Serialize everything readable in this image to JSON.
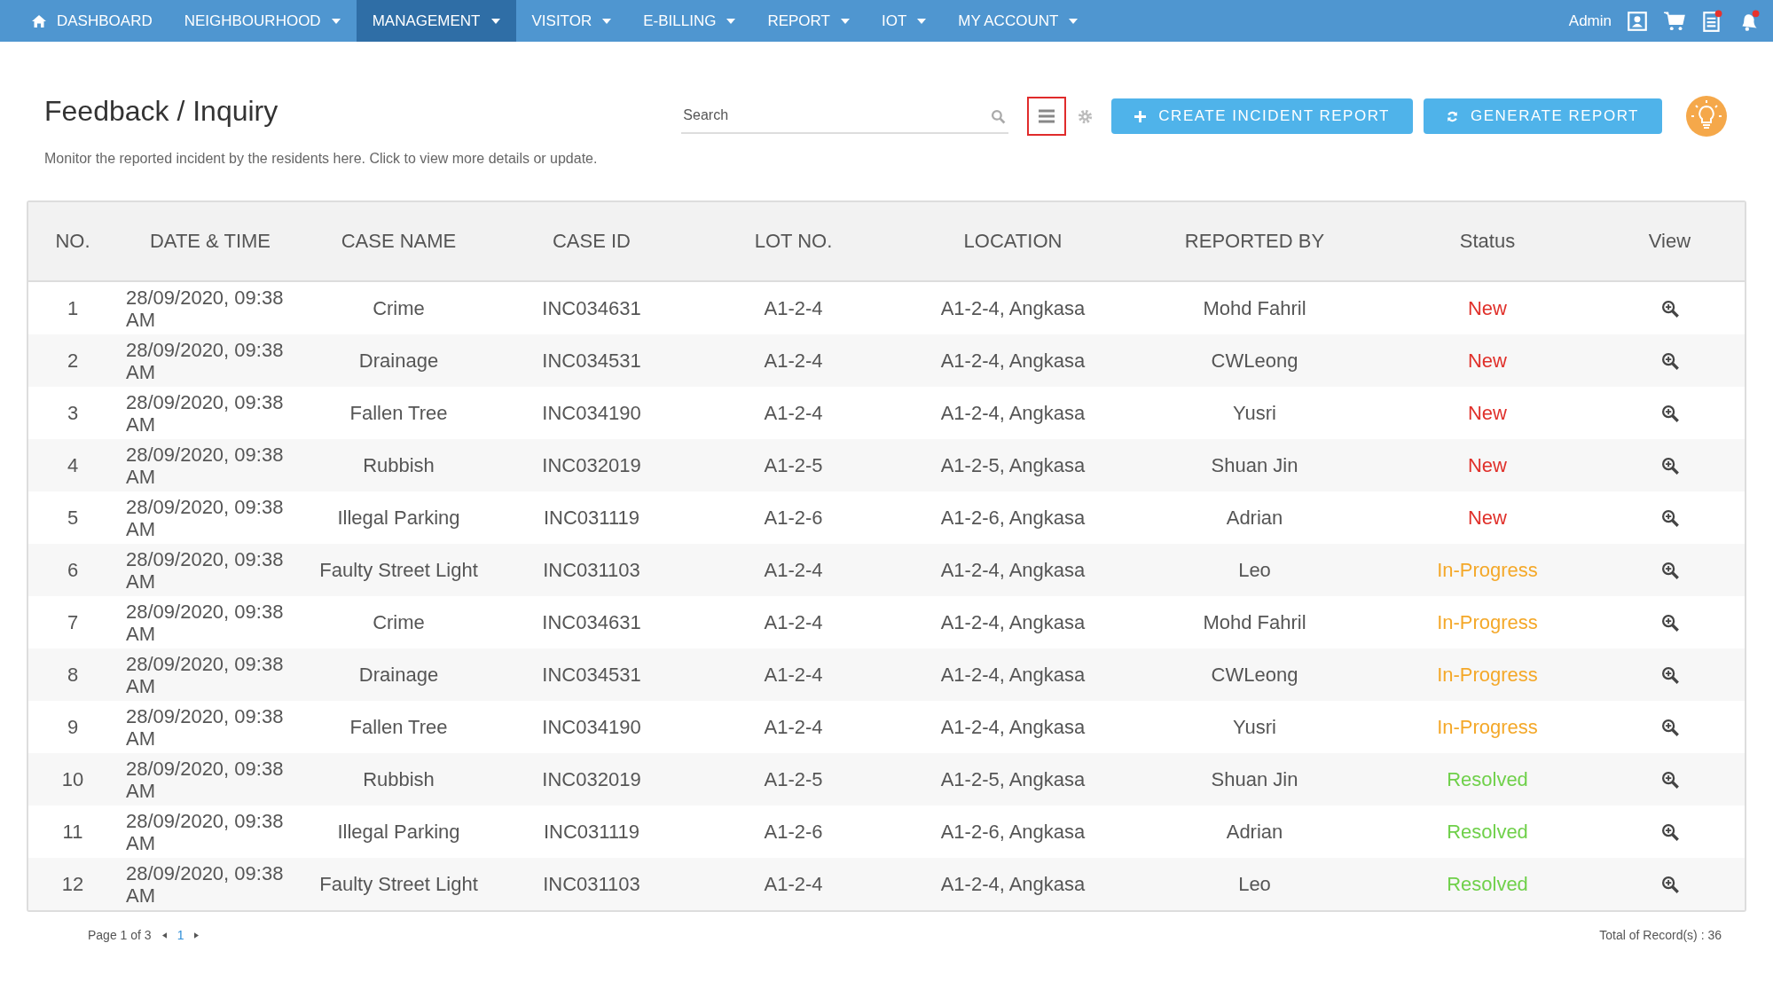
{
  "nav": {
    "items": [
      {
        "label": "DASHBOARD",
        "kind": "home",
        "selected": false
      },
      {
        "label": "NEIGHBOURHOOD",
        "kind": "menu",
        "selected": false
      },
      {
        "label": "MANAGEMENT",
        "kind": "menu",
        "selected": true
      },
      {
        "label": "VISITOR",
        "kind": "menu",
        "selected": false
      },
      {
        "label": "E-BILLING",
        "kind": "menu",
        "selected": false
      },
      {
        "label": "REPORT",
        "kind": "menu",
        "selected": false
      },
      {
        "label": "IOT",
        "kind": "menu",
        "selected": false
      },
      {
        "label": "MY ACCOUNT",
        "kind": "menu",
        "selected": false
      }
    ],
    "user": "Admin"
  },
  "page": {
    "title": "Feedback / Inquiry",
    "description": "Monitor the reported incident by the residents here. Click to view more details or update.",
    "search": {
      "placeholder": "Search"
    },
    "buttons": [
      "CREATE INCIDENT REPORT",
      "GENERATE REPORT"
    ]
  },
  "table": {
    "columns": [
      "NO.",
      "DATE & TIME",
      "CASE NAME",
      "CASE ID",
      "LOT NO.",
      "LOCATION",
      "REPORTED BY",
      "Status",
      "View"
    ],
    "rows": [
      {
        "no": "1",
        "date": "28/09/2020, 09:38 AM",
        "case_name": "Crime",
        "case_id": "INC034631",
        "lot": "A1-2-4",
        "location": "A1-2-4, Angkasa",
        "reported_by": "Mohd Fahril",
        "status": "New",
        "color": "#e0302a"
      },
      {
        "no": "2",
        "date": "28/09/2020, 09:38 AM",
        "case_name": "Drainage",
        "case_id": "INC034531",
        "lot": "A1-2-4",
        "location": "A1-2-4, Angkasa",
        "reported_by": "CWLeong",
        "status": "New",
        "color": "#e0302a"
      },
      {
        "no": "3",
        "date": "28/09/2020, 09:38 AM",
        "case_name": "Fallen Tree",
        "case_id": "INC034190",
        "lot": "A1-2-4",
        "location": "A1-2-4, Angkasa",
        "reported_by": "Yusri",
        "status": "New",
        "color": "#e0302a"
      },
      {
        "no": "4",
        "date": "28/09/2020, 09:38 AM",
        "case_name": "Rubbish",
        "case_id": "INC032019",
        "lot": "A1-2-5",
        "location": "A1-2-5, Angkasa",
        "reported_by": "Shuan Jin",
        "status": "New",
        "color": "#e0302a"
      },
      {
        "no": "5",
        "date": "28/09/2020, 09:38 AM",
        "case_name": "Illegal Parking",
        "case_id": "INC031119",
        "lot": "A1-2-6",
        "location": "A1-2-6, Angkasa",
        "reported_by": "Adrian",
        "status": "New",
        "color": "#e0302a"
      },
      {
        "no": "6",
        "date": "28/09/2020, 09:38 AM",
        "case_name": "Faulty Street Light",
        "case_id": "INC031103",
        "lot": "A1-2-4",
        "location": "A1-2-4, Angkasa",
        "reported_by": "Leo",
        "status": "In-Progress",
        "color": "#f4a829"
      },
      {
        "no": "7",
        "date": "28/09/2020, 09:38 AM",
        "case_name": "Crime",
        "case_id": "INC034631",
        "lot": "A1-2-4",
        "location": "A1-2-4, Angkasa",
        "reported_by": "Mohd Fahril",
        "status": "In-Progress",
        "color": "#f4a829"
      },
      {
        "no": "8",
        "date": "28/09/2020, 09:38 AM",
        "case_name": "Drainage",
        "case_id": "INC034531",
        "lot": "A1-2-4",
        "location": "A1-2-4, Angkasa",
        "reported_by": "CWLeong",
        "status": "In-Progress",
        "color": "#f4a829"
      },
      {
        "no": "9",
        "date": "28/09/2020, 09:38 AM",
        "case_name": "Fallen Tree",
        "case_id": "INC034190",
        "lot": "A1-2-4",
        "location": "A1-2-4, Angkasa",
        "reported_by": "Yusri",
        "status": "In-Progress",
        "color": "#f4a829"
      },
      {
        "no": "10",
        "date": "28/09/2020, 09:38 AM",
        "case_name": "Rubbish",
        "case_id": "INC032019",
        "lot": "A1-2-5",
        "location": "A1-2-5, Angkasa",
        "reported_by": "Shuan Jin",
        "status": "Resolved",
        "color": "#6fd04a"
      },
      {
        "no": "11",
        "date": "28/09/2020, 09:38 AM",
        "case_name": "Illegal Parking",
        "case_id": "INC031119",
        "lot": "A1-2-6",
        "location": "A1-2-6, Angkasa",
        "reported_by": "Adrian",
        "status": "Resolved",
        "color": "#6fd04a"
      },
      {
        "no": "12",
        "date": "28/09/2020, 09:38 AM",
        "case_name": "Faulty Street Light",
        "case_id": "INC031103",
        "lot": "A1-2-4",
        "location": "A1-2-4, Angkasa",
        "reported_by": "Leo",
        "status": "Resolved",
        "color": "#6fd04a"
      }
    ]
  },
  "pagination": {
    "label": "Page 1 of 3",
    "pages": [
      {
        "label": "1",
        "selected": true
      }
    ],
    "total": "Total of Record(s) : 36"
  }
}
